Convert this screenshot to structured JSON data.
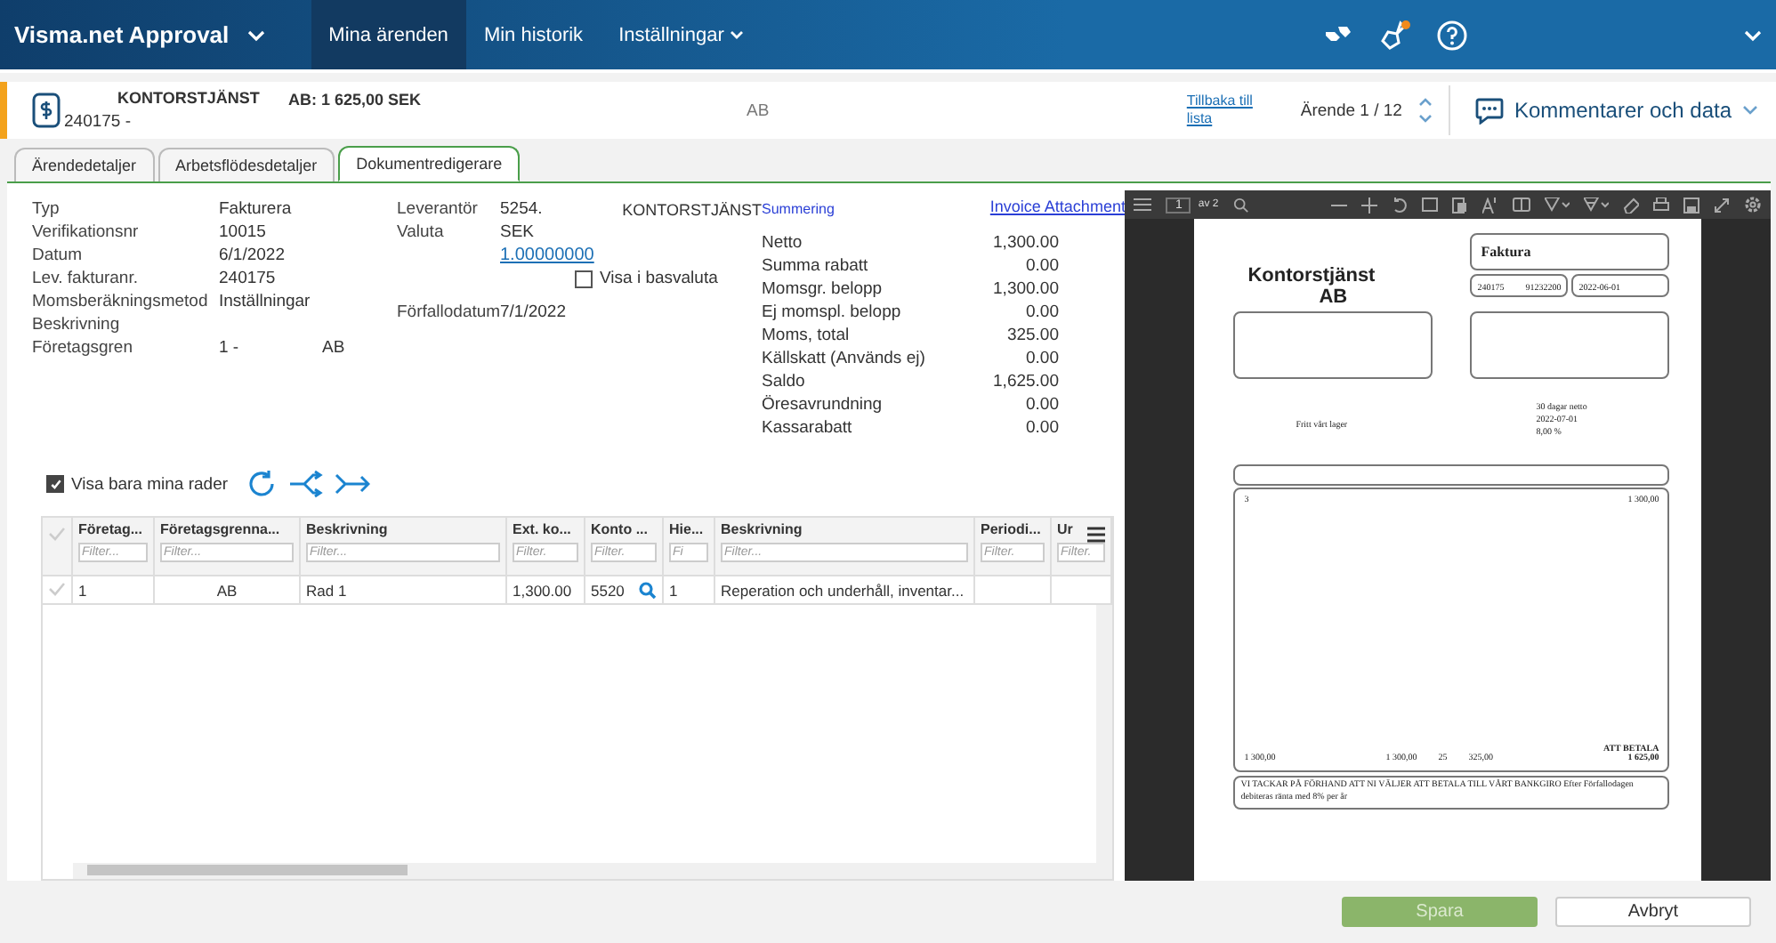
{
  "app_bar": {
    "title": "Visma.net Approval",
    "nav": [
      {
        "label": "Mina ärenden",
        "selected": true,
        "dropdown": false
      },
      {
        "label": "Min historik",
        "selected": false,
        "dropdown": false
      },
      {
        "label": "Inställningar",
        "selected": false,
        "dropdown": true
      }
    ],
    "notification": true
  },
  "case_bar": {
    "title": "KONTORSTJÄNST",
    "number": "240175 -",
    "amount": "AB: 1 625,00 SEK",
    "company": "AB",
    "back_link": "Tillbaka till lista",
    "counter": "Ärende 1 / 12",
    "comments": "Kommentarer och data"
  },
  "tabs": [
    {
      "label": "Ärendedetaljer",
      "selected": false
    },
    {
      "label": "Arbetsflödesdetaljer",
      "selected": false
    },
    {
      "label": "Dokumentredigerare",
      "selected": true
    }
  ],
  "details": [
    {
      "label": "Typ",
      "value": "Fakturera"
    },
    {
      "label": "Verifikationsnr",
      "value": "10015"
    },
    {
      "label": "Datum",
      "value": "6/1/2022"
    },
    {
      "label": "Lev. fakturanr.",
      "value": "240175"
    },
    {
      "label": "Momsberäkningsmetod",
      "value": "Inställningar"
    },
    {
      "label": "Beskrivning"
    },
    {
      "label": "Företagsgren",
      "value": "1 -",
      "value_2": "AB"
    }
  ],
  "supplier": {
    "label": "Leverantör",
    "id": "5254.",
    "name": "KONTORSTJÄNST",
    "currency_label": "Valuta",
    "currency": "SEK",
    "rate": "1.00000000",
    "base_currency": {
      "label": "Visa i basvaluta",
      "checked": false
    },
    "due_label": "Förfallodatum",
    "due": "7/1/2022"
  },
  "summary_link": "Summering",
  "attachment_link": "Invoice Attachment",
  "summary": [
    {
      "label": "Netto",
      "value": "1,300.00"
    },
    {
      "label": "Summa rabatt",
      "value": "0.00"
    },
    {
      "label": "Momsgr. belopp",
      "value": "1,300.00"
    },
    {
      "label": "Ej momspl. belopp",
      "value": "0.00"
    },
    {
      "label": "Moms, total",
      "value": "325.00"
    },
    {
      "label": "Källskatt (Används ej)",
      "value": "0.00"
    },
    {
      "label": "Saldo",
      "value": "1,625.00"
    },
    {
      "label": "Öresavrundning",
      "value": "0.00"
    },
    {
      "label": "Kassarabatt",
      "value": "0.00"
    }
  ],
  "own_rows": {
    "label": "Visa bara mina rader",
    "checked": true
  },
  "table": {
    "all_selected": false,
    "columns": [
      {
        "title": "Företag...",
        "placeholder": "Filter..."
      },
      {
        "title": "Företagsgrenna...",
        "placeholder": "Filter..."
      },
      {
        "title": "Beskrivning",
        "placeholder": "Filter..."
      },
      {
        "title": "Ext. ko...",
        "placeholder": "Filter."
      },
      {
        "title": "Konto ...",
        "placeholder": "Filter."
      },
      {
        "title": "Hie...",
        "placeholder": "Fi"
      },
      {
        "title": "Beskrivning",
        "placeholder": "Filter..."
      },
      {
        "title": "Periodi...",
        "placeholder": "Filter."
      },
      {
        "title": "Ur",
        "placeholder": "Filter."
      }
    ],
    "rows": [
      {
        "selected": false,
        "cells": [
          "1",
          "AB",
          "Rad 1",
          "1,300.00",
          "5520",
          "1",
          "Reperation och underhåll, inventar...",
          "",
          ""
        ]
      }
    ]
  },
  "viewer": {
    "page": "1",
    "page_count": "av 2",
    "document": {
      "company": "Kontorstjänst",
      "company_2": "AB",
      "title": "Faktura",
      "invoice_no": "240175",
      "customer_no": "91232200",
      "date": "2022-06-01",
      "terms": "30 dagar netto",
      "due": "2022-07-01",
      "interest": "8,00 %",
      "delivery": "Fritt vårt lager",
      "row_qty": "3",
      "row_amount": "1 300,00",
      "net": "1 300,00",
      "vat_base": "1 300,00",
      "vat_rate": "25",
      "vat": "325,00",
      "to_pay_label": "ATT BETALA",
      "to_pay": "1 625,00",
      "thanks": "VI TACKAR PÅ FÖRHAND ATT NI VÄLJER ATT BETALA TILL VÅRT BANKGIRO Efter Förfallodagen debiteras ränta med 8% per år"
    }
  },
  "buttons": [
    {
      "label": "Spara",
      "kind": "primary",
      "disabled": true
    },
    {
      "label": "Avbryt",
      "kind": "secondary",
      "disabled": false
    }
  ]
}
